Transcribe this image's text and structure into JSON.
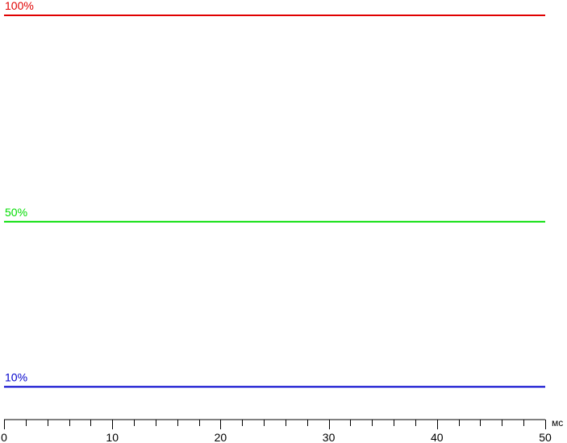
{
  "chart_data": {
    "type": "line",
    "title": "",
    "xlabel": "",
    "ylabel": "",
    "x_unit": "мс",
    "xlim": [
      0,
      50
    ],
    "ylim": [
      0,
      100
    ],
    "x_ticks_major": [
      0,
      10,
      20,
      30,
      40,
      50
    ],
    "x_minor_step": 2,
    "grid": false,
    "series": [
      {
        "name": "100%",
        "color": "#e00000",
        "x": [
          0,
          50
        ],
        "y": [
          100,
          100
        ]
      },
      {
        "name": "50%",
        "color": "#00dd00",
        "x": [
          0,
          50
        ],
        "y": [
          50,
          50
        ]
      },
      {
        "name": "10%",
        "color": "#0000cc",
        "x": [
          0,
          50
        ],
        "y": [
          10,
          10
        ]
      }
    ]
  }
}
